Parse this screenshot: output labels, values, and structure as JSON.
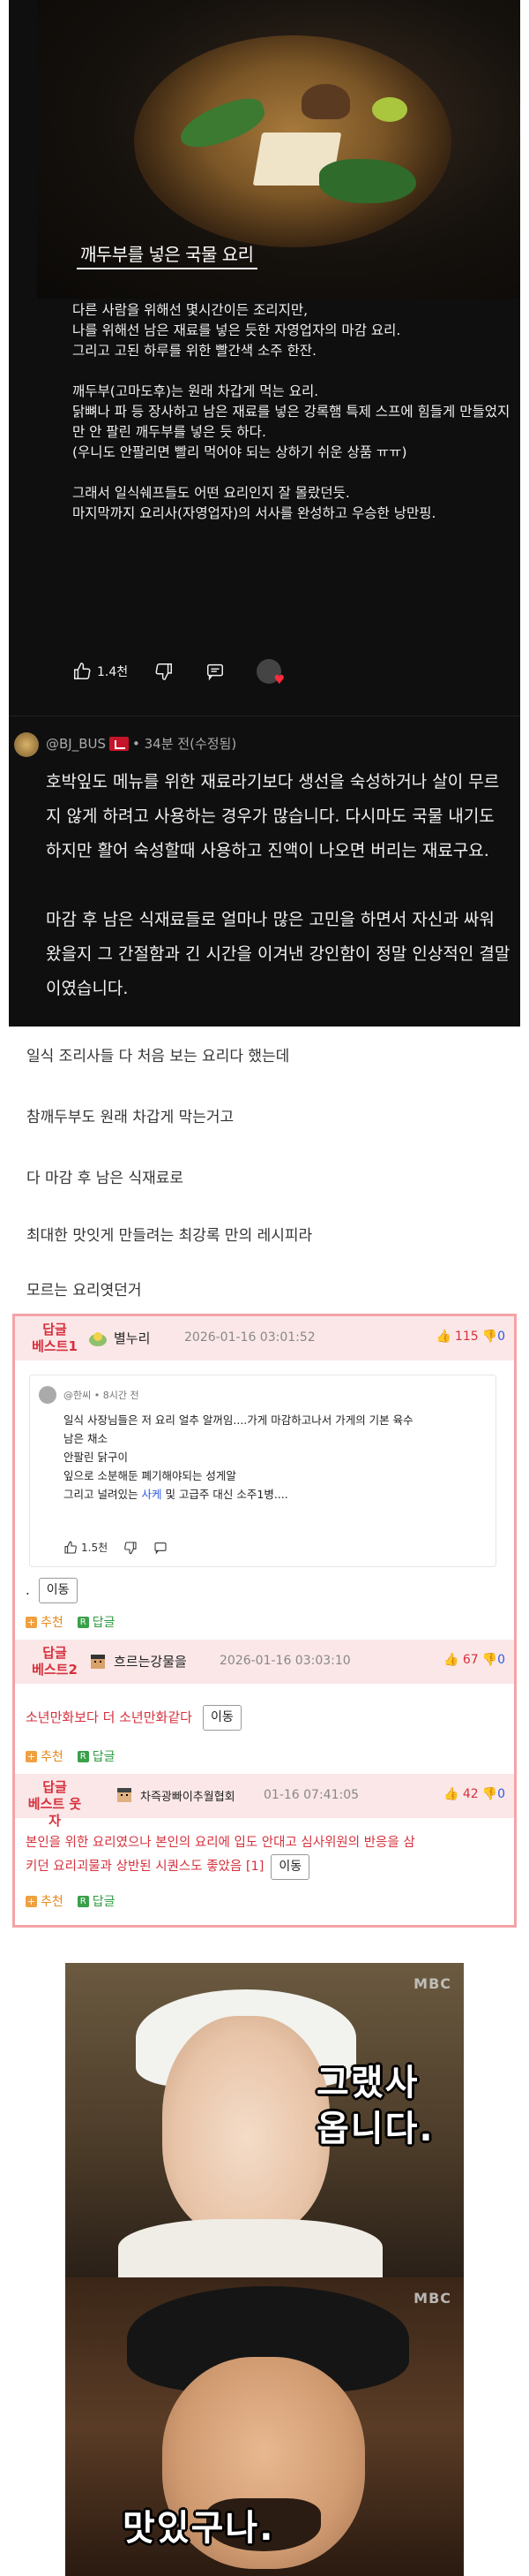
{
  "top_comment": {
    "image_caption": "깨두부를 넣은 국물 요리",
    "paragraphs": [
      "다른 사람을 위해선 몇시간이든 조리지만,\n나를 위해선 남은 재료를 넣은 듯한 자영업자의 마감 요리.\n그리고 고된 하루를 위한 빨간색 소주 한잔.",
      "깨두부(고마도후)는 원래 차갑게 먹는 요리.\n닭뼈나 파 등 장사하고 남은 재료를 넣은 강록햄 특제 스프에 힘들게 만들었지만 안 팔린 깨두부를 넣은 듯 하다.\n(우니도 안팔리면 빨리 먹어야 되는 상하기 쉬운 상품 ㅠㅠ)",
      "그래서 일식쉐프들도 어떤 요리인지 잘 몰랐던듯.\n마지막까지 요리사(자영업자)의 서사를 완성하고 우승한 낭만핑."
    ],
    "like_count": "1.4천"
  },
  "second_comment": {
    "username": "@BJ_BUS",
    "time": "34분 전(수정됨)",
    "paragraphs": [
      "호박잎도 메뉴를 위한 재료라기보다 생선을 숙성하거나 살이 무르지 않게 하려고 사용하는 경우가 많습니다. 다시마도 국물 내기도 하지만 활어 숙성할때 사용하고 진액이 나오면 버리는 재료구요.",
      "마감 후 남은 식재료들로 얼마나 많은 고민을 하면서 자신과 싸워 왔을지 그 간절함과 긴 시간을 이겨낸 강인함이 정말 인상적인 결말이였습니다."
    ]
  },
  "body_lines": [
    "일식 조리사들 다 처음 보는 요리다 했는데",
    "참깨두부도 원래 차갑게 막는거고",
    "다 마감 후 남은 식재료로",
    "최대한 맛잇게 만들려는 최강록 만의 레시피라",
    "모르는 요리엿던거"
  ],
  "best_comments": [
    {
      "label": "답글\n베스트1",
      "nickname": "별누리",
      "date": "2026-01-16 03:01:52",
      "up": "115",
      "down": "0",
      "embed": {
        "header": "@한씨 • 8시간 전",
        "text_before": "일식 사장님들은 저 요리 얼추 알꺼임....가게 마감하고나서 가게의 기본 육수\n남은 채소\n안팔린 닭구이\n잎으로 소분해둔 폐기해야되는 성게알\n그리고 널려있는 ",
        "highlight": "사케",
        "text_after": " 및 고급주 대신 소주1병....",
        "likes": "1.5천"
      },
      "body": ".",
      "move_label": "이동"
    },
    {
      "label": "답글\n베스트2",
      "nickname": "흐르는강물을",
      "date": "2026-01-16 03:03:10",
      "up": "67",
      "down": "0",
      "body": "소년만화보다 더 소년만화같다",
      "move_label": "이동"
    },
    {
      "label": "답글\n베스트 웃자",
      "nickname": "차즉광빠이추월협회",
      "date": "01-16 07:41:05",
      "up": "42",
      "down": "0",
      "body_line1": "본인을 위한 요리였으나 본인의 요리에 입도 안대고 심사위원의 반응을 삼",
      "body_line2": "키던 요리괴물과 상반된 시퀀스도 좋았음 [1]",
      "move_label": "이동"
    }
  ],
  "footer_labels": {
    "recommend": "추천",
    "reply": "답글"
  },
  "meme": {
    "watermark": "MBC",
    "caption_top": "그랬사\n옵니다.",
    "caption_bottom": "맛있구나."
  }
}
